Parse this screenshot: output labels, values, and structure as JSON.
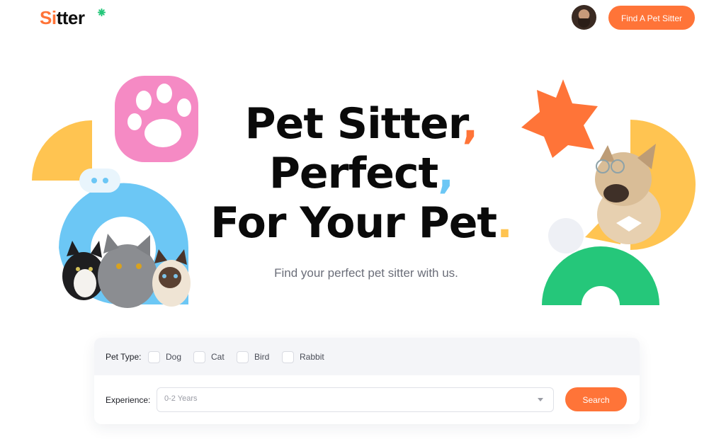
{
  "header": {
    "logo_part1": "Si",
    "logo_part2": "tter",
    "cta_label": "Find A Pet Sitter"
  },
  "hero": {
    "line1": "Pet Sitter",
    "line1_punct": ",",
    "line2": "Perfect",
    "line2_punct": ",",
    "line3": "For Your Pet",
    "line3_punct": ".",
    "subtitle": "Find your perfect pet sitter with us."
  },
  "search_panel": {
    "pet_type_label": "Pet Type:",
    "pet_options": [
      "Dog",
      "Cat",
      "Bird",
      "Rabbit"
    ],
    "experience_label": "Experience:",
    "experience_value": "0-2 Years",
    "search_label": "Search"
  },
  "colors": {
    "accent": "#ff7438",
    "blue": "#6cc7f5",
    "yellow": "#ffc451",
    "pink": "#f58ac4",
    "green": "#25c77a"
  }
}
